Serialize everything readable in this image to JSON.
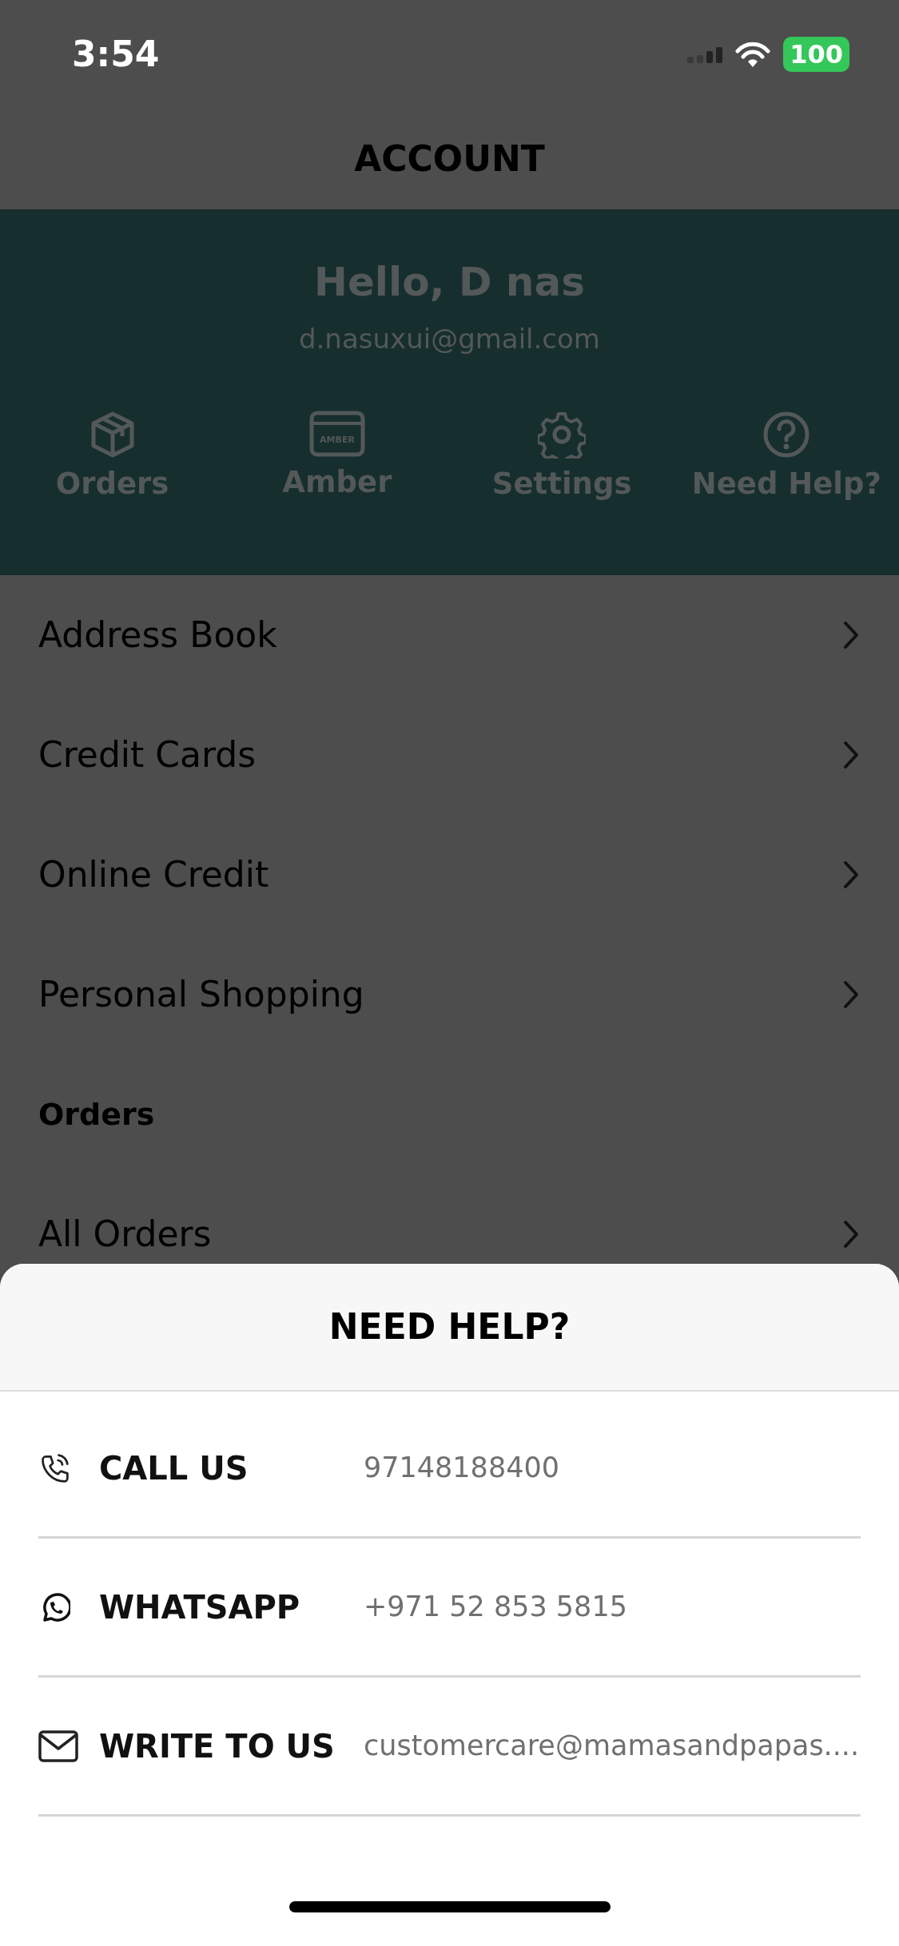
{
  "status_bar": {
    "time": "3:54",
    "battery": "100"
  },
  "header": {
    "title": "ACCOUNT"
  },
  "profile": {
    "greeting": "Hello, D nas",
    "email": "d.nasuxui@gmail.com",
    "shortcuts": [
      {
        "kind": "box",
        "label": "Orders"
      },
      {
        "kind": "card",
        "label": "Amber",
        "card_text": "AMBER"
      },
      {
        "kind": "gear",
        "label": "Settings"
      },
      {
        "kind": "help",
        "label": "Need Help?"
      }
    ]
  },
  "menu": [
    {
      "kind": "link",
      "label": "Address Book"
    },
    {
      "kind": "link",
      "label": "Credit Cards"
    },
    {
      "kind": "link",
      "label": "Online Credit"
    },
    {
      "kind": "link",
      "label": "Personal Shopping"
    },
    {
      "kind": "heading",
      "label": "Orders"
    },
    {
      "kind": "link",
      "label": "All Orders"
    }
  ],
  "sheet": {
    "title": "NEED HELP?",
    "contacts": [
      {
        "kind": "phone",
        "label": "CALL US",
        "value": "97148188400"
      },
      {
        "kind": "whatsapp",
        "label": "WHATSAPP",
        "value": "+971 52 853 5815"
      },
      {
        "kind": "mail",
        "label": "WRITE TO US",
        "value": "customercare@mamasandpapas...."
      }
    ]
  }
}
